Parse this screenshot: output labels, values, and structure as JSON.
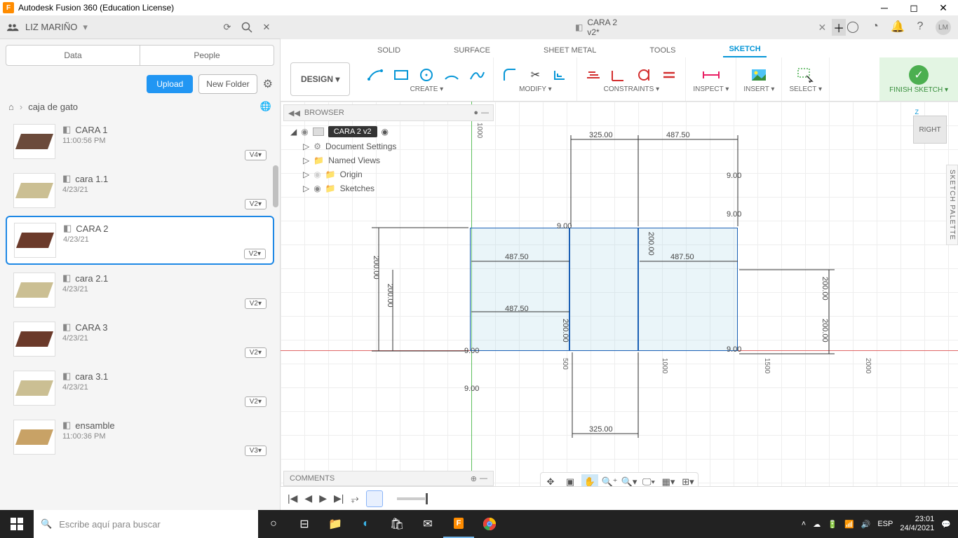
{
  "title_bar": {
    "app_name": "Autodesk Fusion 360 (Education License)"
  },
  "user": {
    "name": "LIZ MARIÑO",
    "avatar_initials": "LM"
  },
  "doc_tab": {
    "label": "CARA 2 v2*"
  },
  "left_panel": {
    "tabs": {
      "data": "Data",
      "people": "People"
    },
    "upload": "Upload",
    "new_folder": "New Folder",
    "breadcrumb": "caja de gato",
    "files": [
      {
        "name": "CARA 1",
        "date": "11:00:56 PM",
        "version": "V4▾",
        "color": "#6b4a3a"
      },
      {
        "name": "cara 1.1",
        "date": "4/23/21",
        "version": "V2▾",
        "color": "#cbbf93"
      },
      {
        "name": "CARA 2",
        "date": "4/23/21",
        "version": "V2▾",
        "color": "#6b3a2a"
      },
      {
        "name": "cara 2.1",
        "date": "4/23/21",
        "version": "V2▾",
        "color": "#cbbf93"
      },
      {
        "name": "CARA 3",
        "date": "4/23/21",
        "version": "V2▾",
        "color": "#6b3a2a"
      },
      {
        "name": "cara 3.1",
        "date": "4/23/21",
        "version": "V2▾",
        "color": "#cbbf93"
      },
      {
        "name": "ensamble",
        "date": "11:00:36 PM",
        "version": "V3▾",
        "color": "#c8a266"
      }
    ],
    "selected_index": 2
  },
  "ribbon": {
    "workspace": "DESIGN ▾",
    "tabs": {
      "solid": "SOLID",
      "surface": "SURFACE",
      "sheetmetal": "SHEET METAL",
      "tools": "TOOLS",
      "sketch": "SKETCH"
    },
    "groups": {
      "create": "CREATE ▾",
      "modify": "MODIFY ▾",
      "constraints": "CONSTRAINTS ▾",
      "inspect": "INSPECT ▾",
      "insert": "INSERT ▾",
      "select": "SELECT ▾",
      "finish": "FINISH SKETCH ▾"
    }
  },
  "browser": {
    "title": "BROWSER",
    "root": "CARA 2 v2",
    "items": [
      "Document Settings",
      "Named Views",
      "Origin",
      "Sketches"
    ]
  },
  "viewcube": {
    "face": "RIGHT",
    "axis": "Z"
  },
  "sketch_palette": "SKETCH PALETTE",
  "dimensions": {
    "top_left": "325.00",
    "top_right": "487.50",
    "topgap1": "9.00",
    "topgap2": "9.00",
    "mid_left": "487.50",
    "mid_right": "487.50",
    "side_l_outer": "200.00",
    "side_l_inner": "200.00",
    "side_r_outer": "200.00",
    "side_r_inner": "200.00",
    "side_r_inner2": "200.00",
    "side_r_inner3": "200.00",
    "bot_left": "487.50",
    "bot_center": "325.00",
    "botgap1": "9.00",
    "botgap2": "9.00",
    "botgap3": "9.00",
    "botgap4": "9.00",
    "small_h": "200.00"
  },
  "rulers": {
    "v1": "1000",
    "v2": "500",
    "v3": "1000",
    "v4": "1500",
    "v5": "2000"
  },
  "comments": "COMMENTS",
  "taskbar": {
    "search_placeholder": "Escribe aquí para buscar",
    "lang": "ESP",
    "time": "23:01",
    "date": "24/4/2021"
  }
}
